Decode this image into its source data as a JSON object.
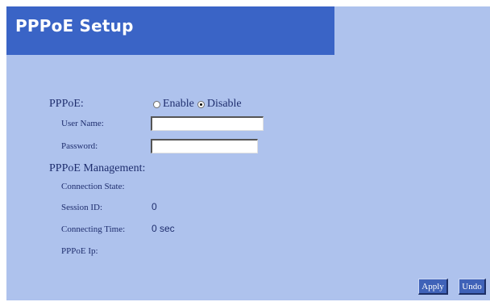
{
  "header": {
    "title": "PPPoE Setup"
  },
  "pppoe": {
    "label": "PPPoE:",
    "enable_label": "Enable",
    "disable_label": "Disable",
    "selected": "Disable"
  },
  "user_name": {
    "label": "User Name:",
    "value": ""
  },
  "password": {
    "label": "Password:",
    "value": ""
  },
  "management": {
    "label": "PPPoE Management:",
    "connection_state_label": "Connection State:",
    "connection_state_value": "",
    "session_id_label": "Session ID:",
    "session_id_value": "0",
    "connecting_time_label": "Connecting Time:",
    "connecting_time_value": "0 sec",
    "pppoe_ip_label": "PPPoE Ip:",
    "pppoe_ip_value": ""
  },
  "buttons": {
    "apply": "Apply",
    "undo": "Undo"
  },
  "colors": {
    "background": "#aec2ed",
    "header": "#3a64c6",
    "button": "#3f62b8",
    "text": "#1f2e6e"
  }
}
